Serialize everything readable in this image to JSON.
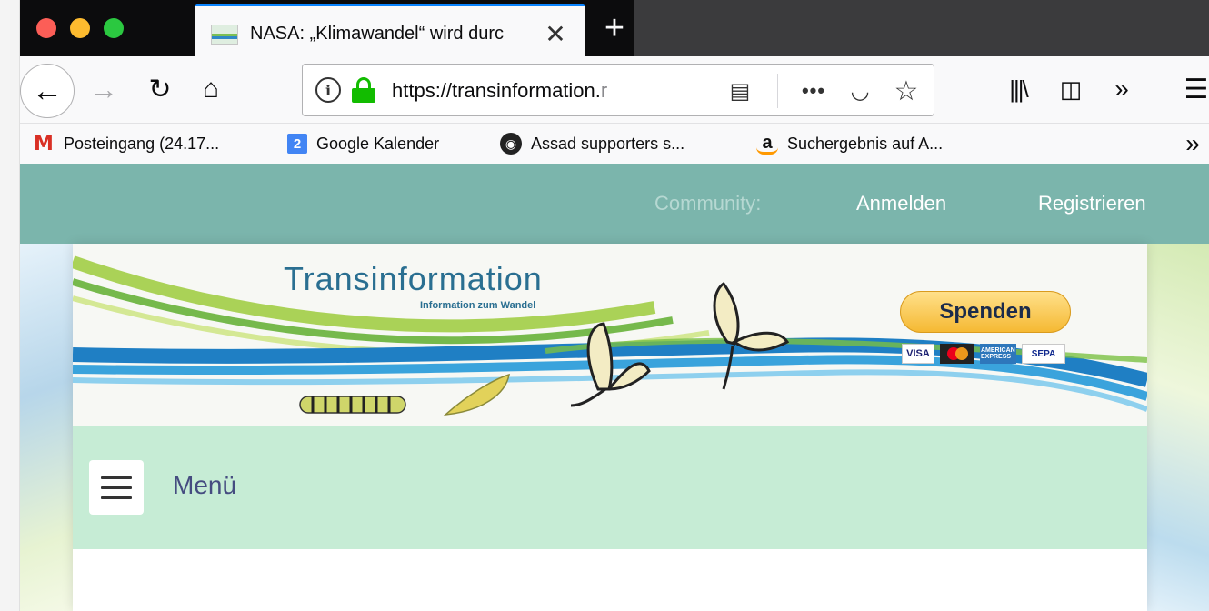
{
  "browser": {
    "tab": {
      "title": "NASA: „Klimawandel“ wird durc",
      "close_glyph": "✕"
    },
    "new_tab_glyph": "+",
    "url": {
      "host_visible": "https://transinformation.",
      "host_faded": "r"
    },
    "bookmarks": [
      {
        "label": "Posteingang (24.17...",
        "icon": "gmail-icon",
        "glyph": "M"
      },
      {
        "label": "Google Kalender",
        "icon": "google-calendar-icon",
        "glyph": "2"
      },
      {
        "label": "Assad supporters s...",
        "icon": "assad-site-icon",
        "glyph": "◉"
      },
      {
        "label": "Suchergebnis auf A...",
        "icon": "amazon-icon",
        "glyph": "a"
      }
    ],
    "bookmarks_overflow_glyph": "»",
    "icons": {
      "back": "←",
      "forward": "→",
      "reload": "↻",
      "home": "⌂",
      "info": "i",
      "reader": "▤",
      "more": "•••",
      "pocket": "◡",
      "star": "☆",
      "library": "|||\\",
      "sidebar": "◫",
      "overflow": "»",
      "menu": "☰"
    }
  },
  "site": {
    "topbar": {
      "community_label": "Community:",
      "login_label": "Anmelden",
      "register_label": "Registrieren"
    },
    "banner": {
      "brand": "Transinformation",
      "tagline": "Information zum Wandel",
      "donate_label": "Spenden",
      "payments": [
        "VISA",
        "",
        "AMERICAN EXPRESS",
        "SEPA"
      ]
    },
    "menu": {
      "label": "Menü"
    }
  },
  "colors": {
    "topbar": "#7bb5ac",
    "menu_bar": "#c6ecd5",
    "brand_blue": "#2a6f91",
    "donate_yellow": "#f5b933",
    "secure_green": "#12bc00"
  }
}
